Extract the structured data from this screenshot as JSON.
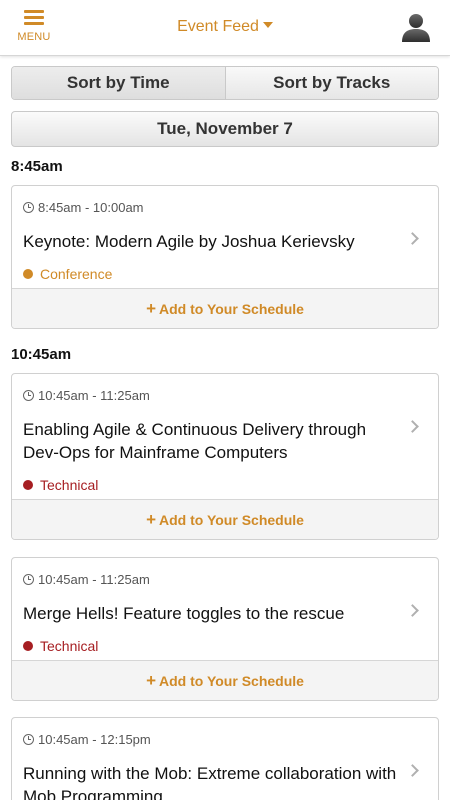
{
  "header": {
    "menu_label": "MENU",
    "title": "Event Feed"
  },
  "sort": {
    "time_label": "Sort by Time",
    "tracks_label": "Sort by Tracks"
  },
  "date_label": "Tue, November 7",
  "groups": [
    {
      "time": "8:45am"
    },
    {
      "time": "10:45am"
    }
  ],
  "sessions": [
    {
      "time": "8:45am - 10:00am",
      "title": "Keynote: Modern Agile by Joshua Kerievsky",
      "track": "Conference",
      "track_color": "#d08a27",
      "action": "Add to Your Schedule"
    },
    {
      "time": "10:45am - 11:25am",
      "title": "Enabling Agile & Continuous Delivery through Dev-Ops for Mainframe Computers",
      "track": "Technical",
      "track_color": "#a61e22",
      "action": "Add to Your Schedule"
    },
    {
      "time": "10:45am - 11:25am",
      "title": "Merge Hells! Feature toggles to the rescue",
      "track": "Technical",
      "track_color": "#a61e22",
      "action": "Add to Your Schedule"
    },
    {
      "time": "10:45am - 12:15pm",
      "title": "Running with the Mob: Extreme collaboration with Mob Programming"
    }
  ],
  "colors": {
    "accent": "#d08a27",
    "conference": "#d08a27",
    "technical": "#a61e22"
  }
}
